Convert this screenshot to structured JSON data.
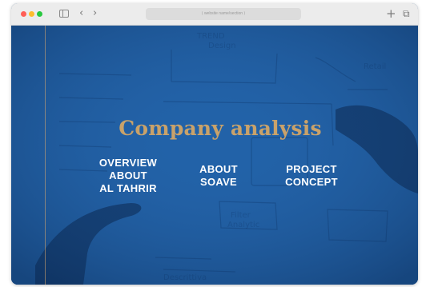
{
  "browser": {
    "url_text": "⟨ website name/section ⟩",
    "new_tab_label": "+",
    "tabs_icon_label": "⧉",
    "back_label": "‹",
    "forward_label": "›"
  },
  "hero": {
    "title": "Company analysis",
    "colors": {
      "title": "#c9a26a",
      "overlay": "#1f5c9e",
      "links": "#ffffff"
    }
  },
  "nav": {
    "overview": "OVERVIEW\nABOUT\nAL TAHRIR",
    "soave": "ABOUT\nSOAVE",
    "project": "PROJECT\nCONCEPT"
  },
  "icons": {
    "close": "close-dot",
    "minimize": "minimize-dot",
    "maximize": "maximize-dot",
    "sidebar": "sidebar-icon",
    "back": "chevron-left-icon",
    "forward": "chevron-right-icon",
    "new_tab": "plus-icon",
    "tabs": "tabs-icon"
  }
}
